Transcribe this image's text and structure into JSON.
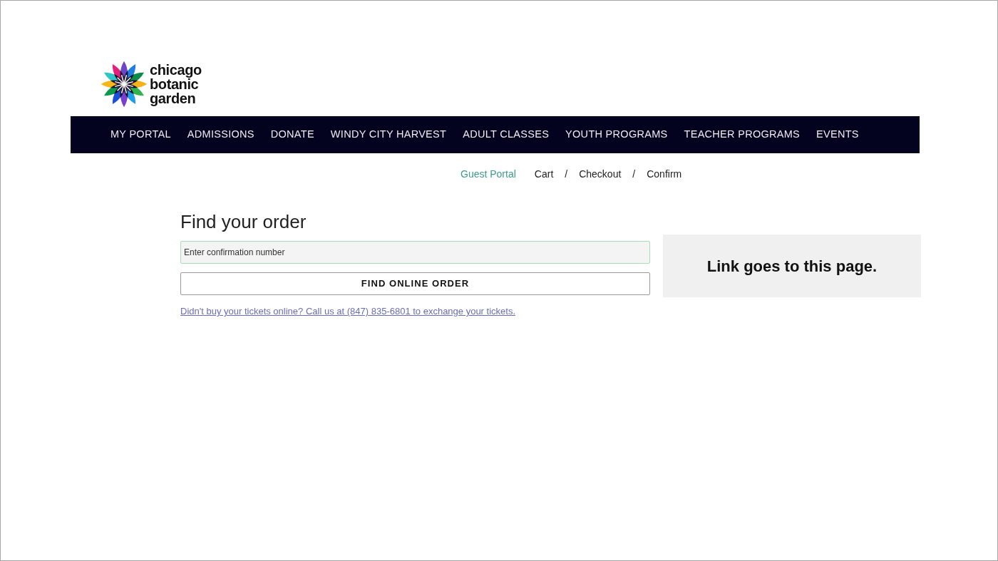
{
  "logo": {
    "lines": [
      "chicago",
      "botanic",
      "garden"
    ]
  },
  "nav": {
    "items": [
      "MY PORTAL",
      "ADMISSIONS",
      "DONATE",
      "WINDY CITY HARVEST",
      "ADULT CLASSES",
      "YOUTH PROGRAMS",
      "TEACHER PROGRAMS",
      "EVENTS"
    ]
  },
  "breadcrumb": [
    {
      "kind": "link",
      "label": "Guest Portal"
    },
    {
      "kind": "step",
      "label": "Cart"
    },
    {
      "kind": "separator",
      "label": "/"
    },
    {
      "kind": "step",
      "label": "Checkout"
    },
    {
      "kind": "separator",
      "label": "/"
    },
    {
      "kind": "step",
      "label": "Confirm"
    }
  ],
  "find_order": {
    "heading": "Find your order",
    "confirmation_field": {
      "placeholder": "Enter confirmation number"
    },
    "button": "FIND ONLINE ORDER",
    "help_link": "Didn't buy your tickets online? Call us at (847) 835-6801 to exchange your tickets."
  },
  "callout": {
    "text": "Link goes to this page."
  }
}
